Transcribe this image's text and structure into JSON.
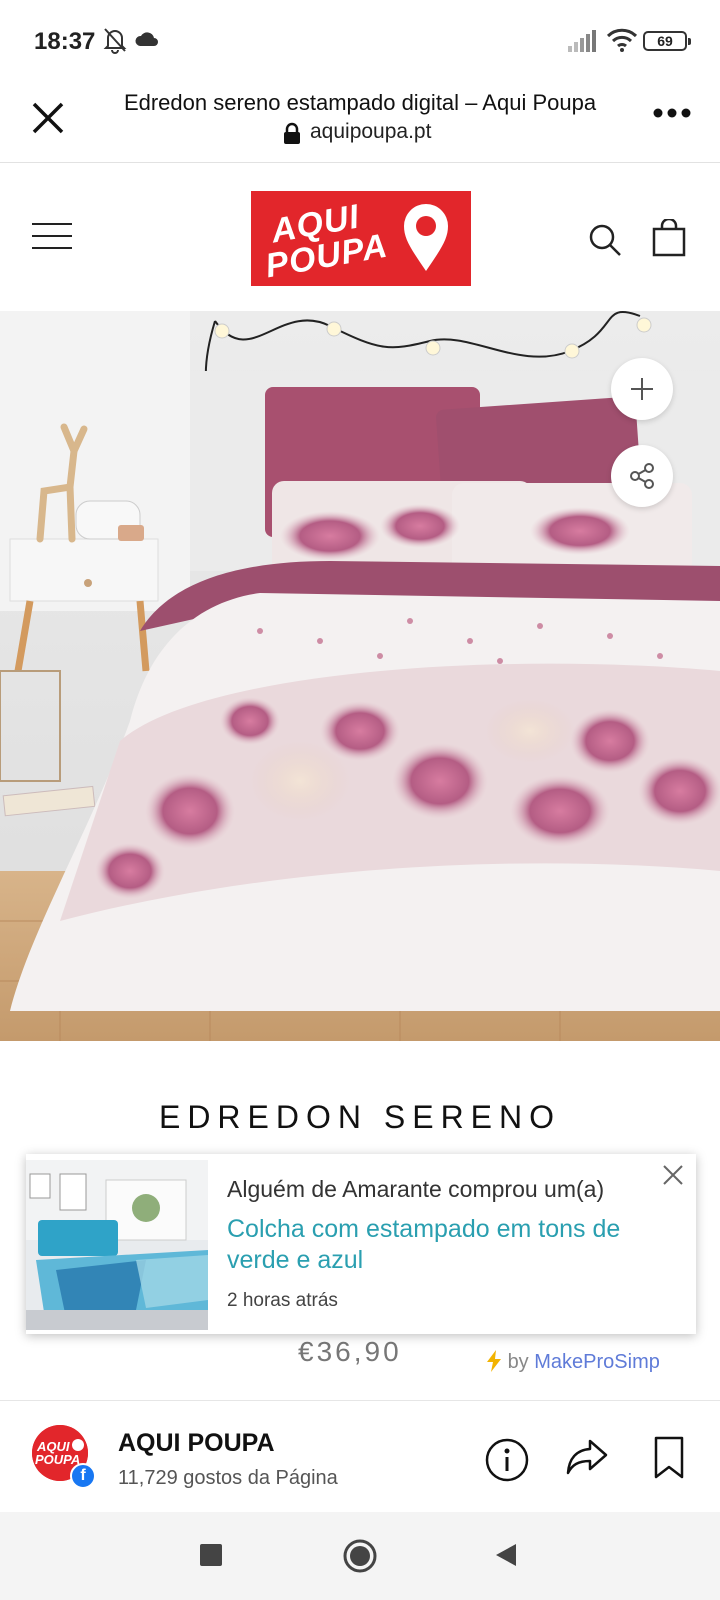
{
  "status_bar": {
    "time": "18:37",
    "battery": "69",
    "icons": [
      "bell-off-icon",
      "cloud-icon",
      "signal-icon",
      "wifi-icon",
      "battery-icon"
    ]
  },
  "browser": {
    "page_title": "Edredon sereno estampado digital – Aqui Poupa",
    "url": "aquipoupa.pt"
  },
  "site_header": {
    "logo_line1": "AQUI",
    "logo_line2": "POUPA",
    "brand_color": "#e2262b"
  },
  "product": {
    "title": "EDREDON SERENO",
    "price": "€36,90"
  },
  "popup": {
    "line1": "Alguém de Amarante comprou um(a)",
    "product_link": "Colcha com estampado em tons de verde e azul",
    "time_ago": "2 horas atrás",
    "link_color": "#2a9fb0"
  },
  "attribution": {
    "by": "by",
    "brand": "MakeProSimp"
  },
  "facebook_bar": {
    "page_name": "AQUI POUPA",
    "likes": "11,729 gostos da Página",
    "avatar_line1": "AQUI",
    "avatar_line2": "POUPA"
  }
}
